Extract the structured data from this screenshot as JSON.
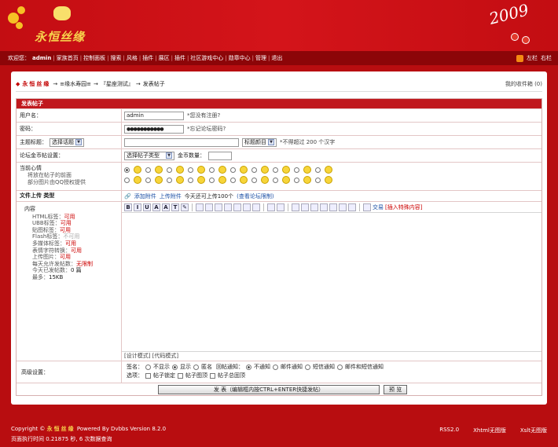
{
  "header": {
    "logo_text": "永恒丝缘",
    "year_text": "2009"
  },
  "nav": {
    "welcome": "欢迎您：",
    "user": "admin",
    "items": [
      "家族首页",
      "控制面板",
      "搜索",
      "风格",
      "插件",
      "展区",
      "插件",
      "社区游戏中心",
      "勋章中心",
      "管理",
      "退出"
    ],
    "right": [
      "左栏",
      "右栏"
    ]
  },
  "breadcrumb": {
    "site": "永恒丝缘",
    "arrow": "→",
    "board1": "≡缘水寿园≡",
    "board2": "『星座测试』",
    "page": "发表帖子",
    "inbox": "我的收件箱",
    "inbox_count": "(0)"
  },
  "form": {
    "title": "发表帖子",
    "username_label": "用户名：",
    "username_value": "admin",
    "username_hint": "*您没有注册?",
    "password_label": "密码：",
    "password_value": "●●●●●●●●●●●",
    "password_hint": "*忘记论坛密码?",
    "subject_label": "主题标题：",
    "subject_select": "选择话题",
    "subject_select2": "标题颜目",
    "subject_hint": "*不得超过 200 个汉字",
    "coin_label": "论坛金币帖设置：",
    "coin_select": "选择帖子类型",
    "coin_qty_label": "金币数量：",
    "mood_label": "当前心情",
    "mood_sub1": "将放在帖子的前面",
    "mood_sub2": "部分图片由QQ授权提供",
    "upload_label": "文件上传 类型",
    "upload_link1": "添加附件",
    "upload_link2": "上传附件",
    "upload_info": "今天还可上传100个",
    "upload_limit": "(查看论坛限制)",
    "content_label": "内容",
    "specs": [
      {
        "k": "HTML标签：",
        "v": "可用"
      },
      {
        "k": "UBB标签：",
        "v": "可用"
      },
      {
        "k": "贴图标签：",
        "v": "可用"
      },
      {
        "k": "Flash标签：",
        "v": "不可用"
      },
      {
        "k": "多媒体标签：",
        "v": "可用"
      },
      {
        "k": "表情字符转换：",
        "v": "可用"
      },
      {
        "k": "上传图片：",
        "v": "可用"
      },
      {
        "k": "每天允许发帖数：",
        "v": "无限制"
      },
      {
        "k": "今天已发帖数：",
        "v": "0 篇"
      },
      {
        "k": "最多：",
        "v": "15KB"
      }
    ],
    "editor_tabs": "[设计模式] [代码模式]",
    "toolbar_exchange": "交易",
    "toolbar_special": "[插入特殊内容]",
    "advanced_label": "高级设置：",
    "sign_label": "签名：",
    "sign_opts": [
      "不显示",
      "显示",
      "匿名"
    ],
    "notify_label": "回帖通知：",
    "notify_opts": [
      "不通知",
      "邮件通知",
      "短信通知",
      "邮件和短信通知"
    ],
    "option_label": "选项：",
    "option_opts": [
      "帖子锁定",
      "帖子图顶",
      "帖子总固顶"
    ],
    "submit_label": "发 表（编辑框内按CTRL+ENTER快捷发帖）",
    "preview_label": "预 览"
  },
  "footer": {
    "copyright": "Copyright ©",
    "site": "永恒丝缘",
    "powered": "Powered By Dvbbs Version 8.2.0",
    "exec": "页面执行时间 0.21875 秒, 6 次数据查询",
    "links": [
      "RSS2.0",
      "Xhtml无图版",
      "Xslt无图版"
    ]
  }
}
